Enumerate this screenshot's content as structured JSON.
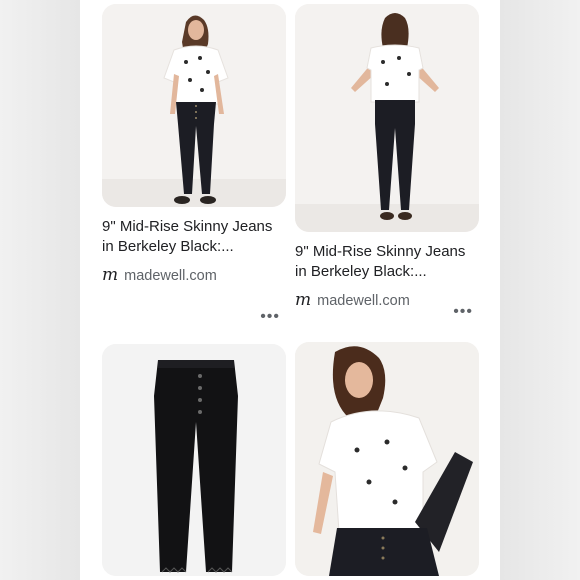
{
  "results": [
    {
      "title_line1": "9\" Mid-Rise Skinny Jeans",
      "title_line2": "in Berkeley Black:...",
      "source": "madewell.com",
      "logo": "m",
      "more": "•••",
      "image": "model-front-white-tee-black-jeans"
    },
    {
      "title_line1": "9\" Mid-Rise Skinny Jeans",
      "title_line2": "in Berkeley Black:...",
      "source": "madewell.com",
      "logo": "m",
      "more": "•••",
      "image": "model-back-white-tee-black-jeans"
    },
    {
      "image": "black-jeans-flat-lay"
    },
    {
      "image": "model-seated-white-tee"
    }
  ]
}
